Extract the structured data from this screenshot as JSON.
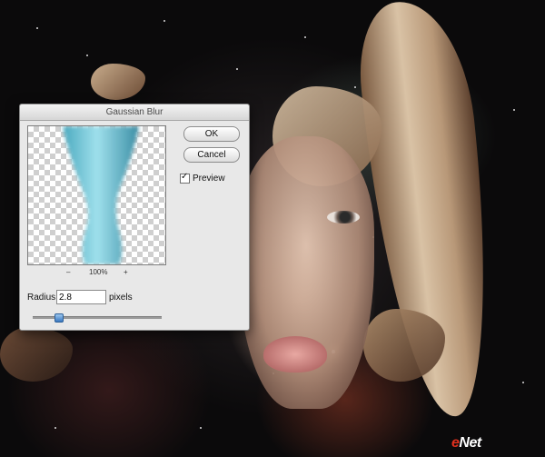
{
  "dialog": {
    "title": "Gaussian Blur",
    "ok_label": "OK",
    "cancel_label": "Cancel",
    "preview_label": "Preview",
    "preview_checked": true,
    "zoom": {
      "minus": "–",
      "value": "100%",
      "plus": "+"
    },
    "radius": {
      "label": "Radius:",
      "value": "2.8",
      "unit": "pixels"
    },
    "slider_level_fraction": 0.18
  },
  "watermark": {
    "brand_e": "e",
    "brand_rest": "Net"
  },
  "colors": {
    "dialog_bg": "#e8e8e8",
    "preview_shape": "#6cc8d8",
    "slider_thumb": "#3a78c0",
    "watermark_accent": "#e0301e"
  }
}
